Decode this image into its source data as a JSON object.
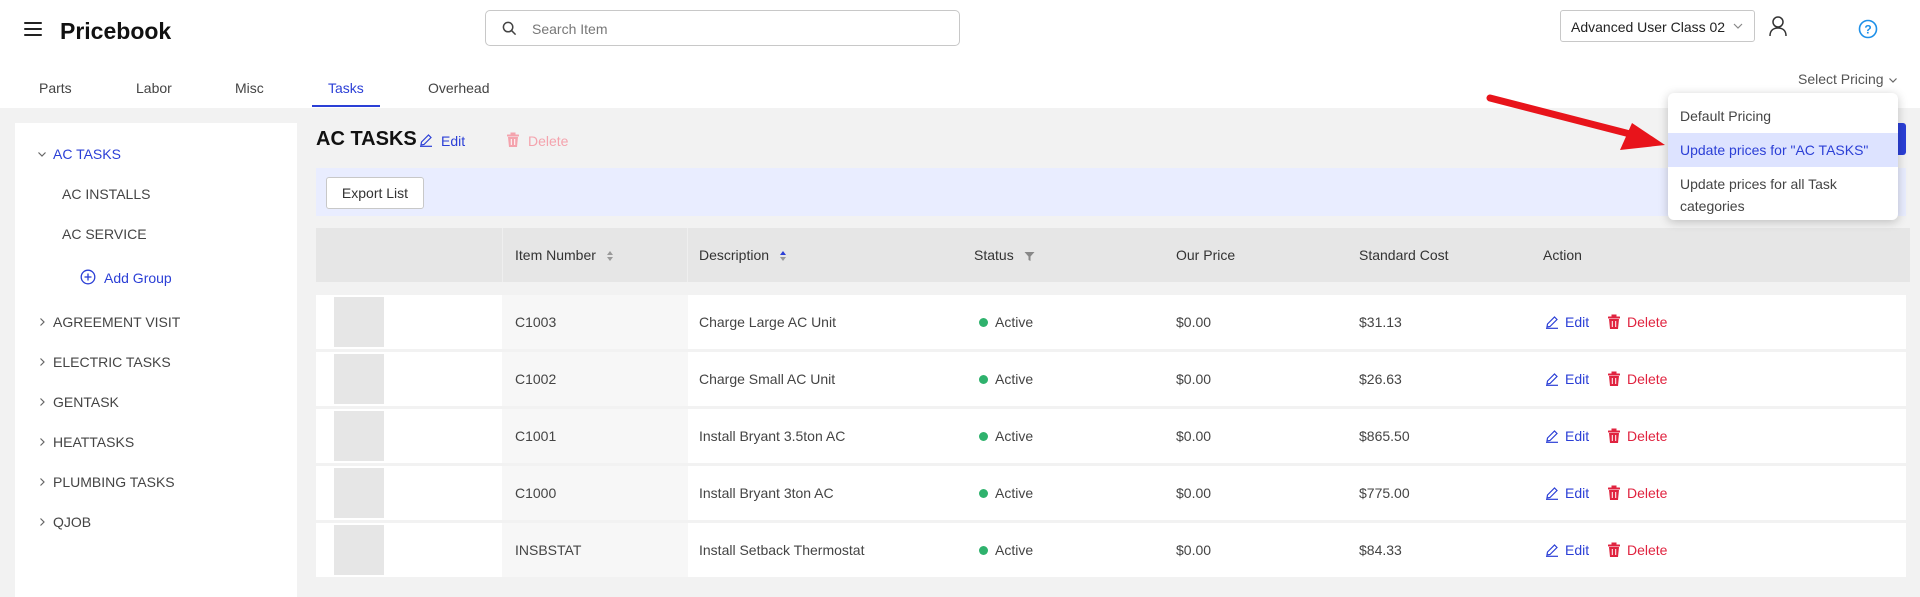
{
  "header": {
    "title": "Pricebook",
    "search_placeholder": "Search Item",
    "user_class": "Advanced User Class 02"
  },
  "tabs": [
    {
      "label": "Parts"
    },
    {
      "label": "Labor"
    },
    {
      "label": "Misc"
    },
    {
      "label": "Tasks",
      "active": true
    },
    {
      "label": "Overhead"
    }
  ],
  "select_pricing": "Select Pricing",
  "sidebar": {
    "active_group": "AC TASKS",
    "sub_items": [
      "AC INSTALLS",
      "AC SERVICE"
    ],
    "add_group": "Add Group",
    "groups": [
      "AGREEMENT VISIT",
      "ELECTRIC TASKS",
      "GENTASK",
      "HEATTASKS",
      "PLUMBING TASKS",
      "QJOB"
    ]
  },
  "main": {
    "title": "AC TASKS",
    "edit": "Edit",
    "delete": "Delete",
    "export": "Export List"
  },
  "table": {
    "headers": [
      "Item Number",
      "Description",
      "Status",
      "Our Price",
      "Standard Cost",
      "Action"
    ],
    "rows": [
      {
        "item": "C1003",
        "desc": "Charge Large AC Unit",
        "status": "Active",
        "price": "$0.00",
        "cost": "$31.13",
        "edit": "Edit",
        "delete": "Delete"
      },
      {
        "item": "C1002",
        "desc": "Charge Small AC Unit",
        "status": "Active",
        "price": "$0.00",
        "cost": "$26.63",
        "edit": "Edit",
        "delete": "Delete"
      },
      {
        "item": "C1001",
        "desc": "Install Bryant 3.5ton AC",
        "status": "Active",
        "price": "$0.00",
        "cost": "$865.50",
        "edit": "Edit",
        "delete": "Delete"
      },
      {
        "item": "C1000",
        "desc": "Install Bryant 3ton AC",
        "status": "Active",
        "price": "$0.00",
        "cost": "$775.00",
        "edit": "Edit",
        "delete": "Delete"
      },
      {
        "item": "INSBSTAT",
        "desc": "Install Setback Thermostat",
        "status": "Active",
        "price": "$0.00",
        "cost": "$84.33",
        "edit": "Edit",
        "delete": "Delete"
      }
    ]
  },
  "dropdown": {
    "items": [
      "Default Pricing",
      "Update prices for \"AC TASKS\"",
      "Update prices for all Task categories"
    ]
  },
  "colors": {
    "accent": "#2b3fd6",
    "danger": "#e0233f",
    "active_status": "#2fb26d",
    "arrow": "#e8141b"
  }
}
